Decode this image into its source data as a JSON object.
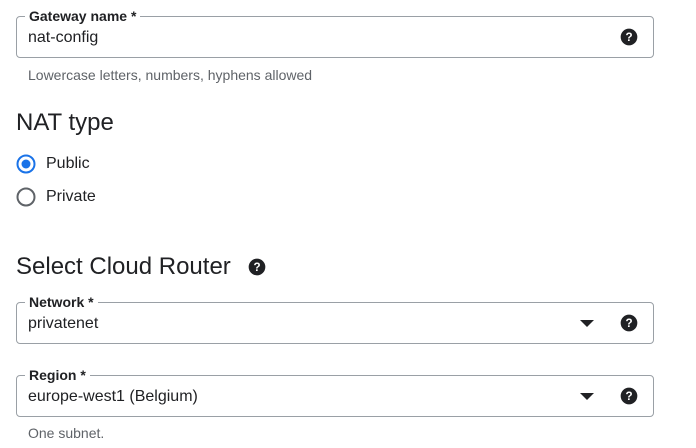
{
  "gateway": {
    "label": "Gateway name *",
    "value": "nat-config",
    "hint": "Lowercase letters, numbers, hyphens allowed",
    "help_icon": "help-circle-icon"
  },
  "nat_type": {
    "title": "NAT type",
    "options": [
      {
        "label": "Public",
        "selected": true
      },
      {
        "label": "Private",
        "selected": false
      }
    ]
  },
  "cloud_router": {
    "title": "Select Cloud Router",
    "help_icon": "help-circle-icon"
  },
  "network": {
    "label": "Network *",
    "value": "privatenet",
    "arrow_icon": "dropdown-arrow-icon",
    "help_icon": "help-circle-icon"
  },
  "region": {
    "label": "Region *",
    "value": "europe-west1 (Belgium)",
    "hint": "One subnet.",
    "arrow_icon": "dropdown-arrow-icon",
    "help_icon": "help-circle-icon"
  },
  "colors": {
    "accent": "#1a73e8",
    "text": "#202124",
    "hint": "#5f6368",
    "border": "#9aa0a6"
  }
}
